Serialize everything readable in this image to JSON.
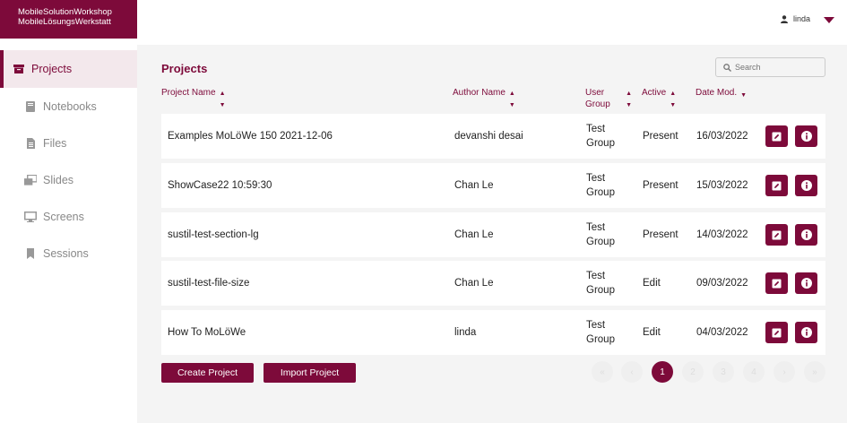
{
  "brand": {
    "line1": "MobileSolutionWorkshop",
    "line2": "MobileLösungsWerkstatt"
  },
  "user": {
    "name": "linda"
  },
  "sidebar": {
    "items": [
      {
        "label": "Projects",
        "icon": "archive-box-icon"
      },
      {
        "label": "Notebooks",
        "icon": "book-icon"
      },
      {
        "label": "Files",
        "icon": "file-icon"
      },
      {
        "label": "Slides",
        "icon": "slides-icon"
      },
      {
        "label": "Screens",
        "icon": "monitor-icon"
      },
      {
        "label": "Sessions",
        "icon": "bookmark-icon"
      }
    ]
  },
  "page": {
    "title": "Projects"
  },
  "search": {
    "placeholder": "Search"
  },
  "table": {
    "headers": {
      "project_name": "Project Name",
      "author_name": "Author Name",
      "user_group": "User Group",
      "active": "Active",
      "date_mod": "Date Mod."
    },
    "rows": [
      {
        "project": "Examples MoLöWe 150 2021-12-06",
        "author": "devanshi desai",
        "group": "Test Group",
        "active": "Present",
        "date": "16/03/2022"
      },
      {
        "project": "ShowCase22 10:59:30",
        "author": "Chan Le",
        "group": "Test Group",
        "active": "Present",
        "date": "15/03/2022"
      },
      {
        "project": "sustil-test-section-lg",
        "author": "Chan Le",
        "group": "Test Group",
        "active": "Present",
        "date": "14/03/2022"
      },
      {
        "project": "sustil-test-file-size",
        "author": "Chan Le",
        "group": "Test Group",
        "active": "Edit",
        "date": "09/03/2022"
      },
      {
        "project": "How To MoLöWe",
        "author": "linda",
        "group": "Test Group",
        "active": "Edit",
        "date": "04/03/2022"
      }
    ]
  },
  "actions": {
    "create": "Create Project",
    "import": "Import Project"
  },
  "pagination": {
    "first": "«",
    "prev": "‹",
    "pages": [
      "1",
      "2",
      "3",
      "4"
    ],
    "current": "1",
    "next": "›",
    "last": "»"
  },
  "colors": {
    "accent": "#7d0a3a",
    "background": "#f4f4f4"
  }
}
